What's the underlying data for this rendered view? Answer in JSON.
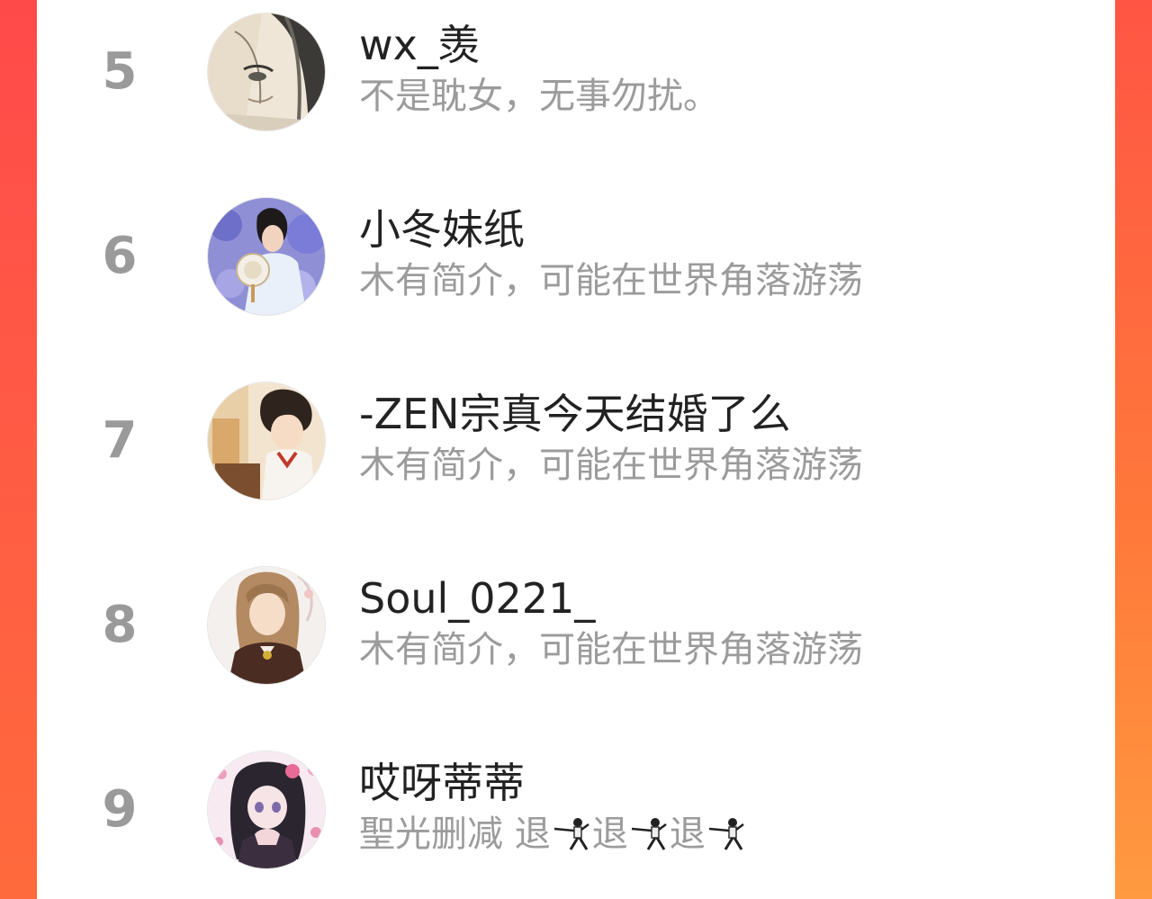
{
  "colors": {
    "background_accent": "#ff5a45",
    "rank_text": "#9a9a9a",
    "name_text": "#222222",
    "bio_text": "#9b9b9b"
  },
  "list": {
    "items": [
      {
        "rank": "5",
        "name": "wx_羡",
        "bio": "不是耽女，无事勿扰。",
        "avatar_icon": "avatar-ink-portrait"
      },
      {
        "rank": "6",
        "name": "小冬妹纸",
        "bio": "木有简介，可能在世界角落游荡",
        "avatar_icon": "avatar-costume-photo"
      },
      {
        "rank": "7",
        "name": "-ZEN宗真今天结婚了么",
        "bio": "木有简介，可能在世界角落游荡",
        "avatar_icon": "avatar-anime-boy"
      },
      {
        "rank": "8",
        "name": "Soul_0221_",
        "bio": "木有简介，可能在世界角落游荡",
        "avatar_icon": "avatar-anime-longhair"
      },
      {
        "rank": "9",
        "name": "哎呀蒂蒂",
        "bio": "聖光删减 退",
        "bio_part2": "退",
        "bio_part3": "退",
        "avatar_icon": "avatar-anime-girl"
      }
    ]
  }
}
